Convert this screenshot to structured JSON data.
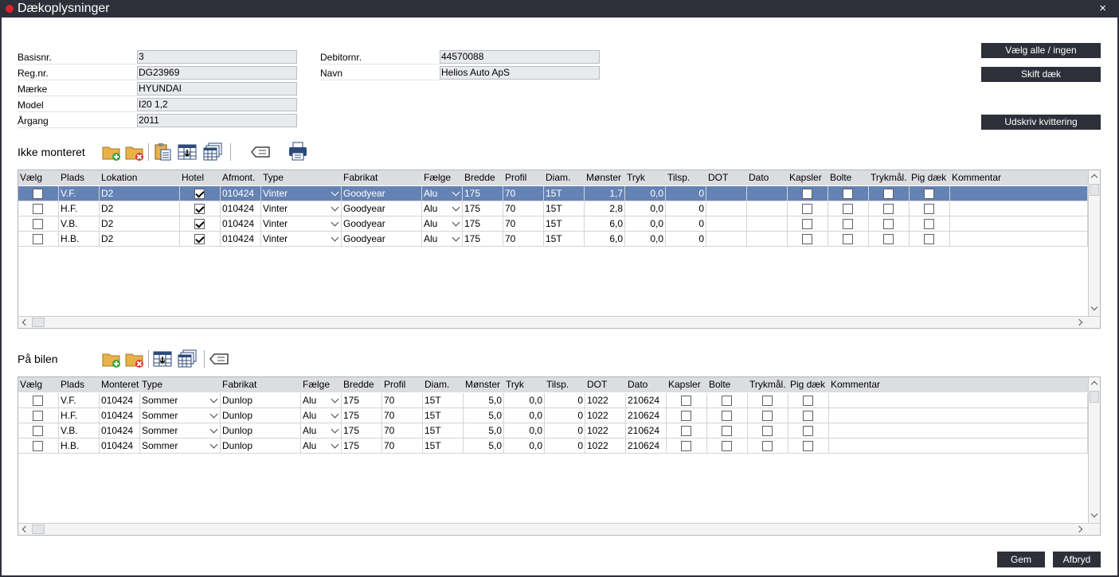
{
  "window": {
    "title": "Dækoplysninger",
    "close": "×"
  },
  "vehicle": {
    "basisnr_label": "Basisnr.",
    "basisnr": "3",
    "regnr_label": "Reg.nr.",
    "regnr": "DG23969",
    "maerke_label": "Mærke",
    "maerke": "HYUNDAI",
    "model_label": "Model",
    "model": "I20 1,2",
    "aargang_label": "Årgang",
    "aargang": "2011",
    "debitornr_label": "Debitornr.",
    "debitornr": "44570088",
    "navn_label": "Navn",
    "navn": "Helios Auto ApS"
  },
  "actions": {
    "select_all": "Vælg alle / ingen",
    "swap_tyres": "Skift dæk",
    "print_receipt": "Udskriv kvittering"
  },
  "not_mounted": {
    "title": "Ikke monteret",
    "icons": [
      "folder-add-icon",
      "folder-delete-icon",
      "clipboard-edit-icon",
      "grid-import-icon",
      "grid-multi-icon",
      "tag-icon",
      "printer-icon"
    ],
    "columns": [
      "Vælg",
      "Plads",
      "Lokation",
      "Hotel",
      "Afmont.",
      "Type",
      "Fabrikat",
      "Fælge",
      "Bredde",
      "Profil",
      "Diam.",
      "Mønster",
      "Tryk",
      "Tilsp.",
      "DOT",
      "Dato",
      "Kapsler",
      "Bolte",
      "Trykmål.",
      "Pig dæk",
      "Kommentar"
    ],
    "rows": [
      {
        "plads": "V.F.",
        "lokation": "D2",
        "hotel": true,
        "afmont": "010424",
        "type": "Vinter",
        "fabrikat": "Goodyear",
        "faelge": "Alu",
        "bredde": "175",
        "profil": "70",
        "diam": "15T",
        "moenster": "1,7",
        "tryk": "0,0",
        "tilsp": "0",
        "dot": "",
        "dato": "",
        "kommentar": ""
      },
      {
        "plads": "H.F.",
        "lokation": "D2",
        "hotel": true,
        "afmont": "010424",
        "type": "Vinter",
        "fabrikat": "Goodyear",
        "faelge": "Alu",
        "bredde": "175",
        "profil": "70",
        "diam": "15T",
        "moenster": "2,8",
        "tryk": "0,0",
        "tilsp": "0",
        "dot": "",
        "dato": "",
        "kommentar": ""
      },
      {
        "plads": "V.B.",
        "lokation": "D2",
        "hotel": true,
        "afmont": "010424",
        "type": "Vinter",
        "fabrikat": "Goodyear",
        "faelge": "Alu",
        "bredde": "175",
        "profil": "70",
        "diam": "15T",
        "moenster": "6,0",
        "tryk": "0,0",
        "tilsp": "0",
        "dot": "",
        "dato": "",
        "kommentar": ""
      },
      {
        "plads": "H.B.",
        "lokation": "D2",
        "hotel": true,
        "afmont": "010424",
        "type": "Vinter",
        "fabrikat": "Goodyear",
        "faelge": "Alu",
        "bredde": "175",
        "profil": "70",
        "diam": "15T",
        "moenster": "6,0",
        "tryk": "0,0",
        "tilsp": "0",
        "dot": "",
        "dato": "",
        "kommentar": ""
      }
    ]
  },
  "on_car": {
    "title": "På bilen",
    "icons": [
      "folder-add-icon",
      "folder-delete-icon",
      "grid-import-icon",
      "grid-multi-icon",
      "tag-icon"
    ],
    "columns": [
      "Vælg",
      "Plads",
      "Monteret",
      "Type",
      "Fabrikat",
      "Fælge",
      "Bredde",
      "Profil",
      "Diam.",
      "Mønster",
      "Tryk",
      "Tilsp.",
      "DOT",
      "Dato",
      "Kapsler",
      "Bolte",
      "Trykmål.",
      "Pig dæk",
      "Kommentar"
    ],
    "rows": [
      {
        "plads": "V.F.",
        "monteret": "010424",
        "type": "Sommer",
        "fabrikat": "Dunlop",
        "faelge": "Alu",
        "bredde": "175",
        "profil": "70",
        "diam": "15T",
        "moenster": "5,0",
        "tryk": "0,0",
        "tilsp": "0",
        "dot": "1022",
        "dato": "210624",
        "kommentar": ""
      },
      {
        "plads": "H.F.",
        "monteret": "010424",
        "type": "Sommer",
        "fabrikat": "Dunlop",
        "faelge": "Alu",
        "bredde": "175",
        "profil": "70",
        "diam": "15T",
        "moenster": "5,0",
        "tryk": "0,0",
        "tilsp": "0",
        "dot": "1022",
        "dato": "210624",
        "kommentar": ""
      },
      {
        "plads": "V.B.",
        "monteret": "010424",
        "type": "Sommer",
        "fabrikat": "Dunlop",
        "faelge": "Alu",
        "bredde": "175",
        "profil": "70",
        "diam": "15T",
        "moenster": "5,0",
        "tryk": "0,0",
        "tilsp": "0",
        "dot": "1022",
        "dato": "210624",
        "kommentar": ""
      },
      {
        "plads": "H.B.",
        "monteret": "010424",
        "type": "Sommer",
        "fabrikat": "Dunlop",
        "faelge": "Alu",
        "bredde": "175",
        "profil": "70",
        "diam": "15T",
        "moenster": "5,0",
        "tryk": "0,0",
        "tilsp": "0",
        "dot": "1022",
        "dato": "210624",
        "kommentar": ""
      }
    ]
  },
  "footer": {
    "save": "Gem",
    "cancel": "Afbryd"
  },
  "colors": {
    "titlebar": "#2d3039",
    "selected_row": "#6582b4",
    "close_dot": "#e0202a"
  }
}
